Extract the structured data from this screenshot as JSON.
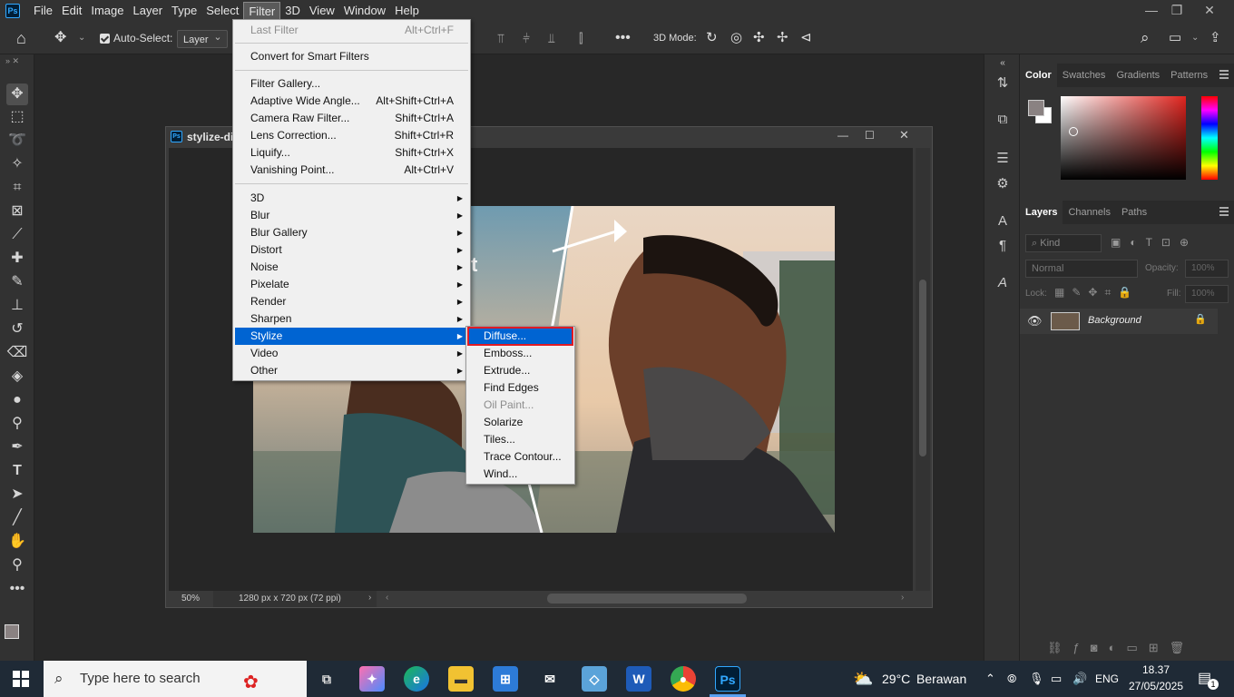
{
  "menubar": {
    "app_icon": "Ps",
    "items": [
      "File",
      "Edit",
      "Image",
      "Layer",
      "Type",
      "Select",
      "Filter",
      "3D",
      "View",
      "Window",
      "Help"
    ],
    "active": "Filter"
  },
  "options": {
    "auto_select_label": "Auto-Select:",
    "auto_select_target": "Layer",
    "mode_3d_label": "3D Mode:"
  },
  "document": {
    "title": "stylize-dif",
    "zoom": "50%",
    "info": "1280 px x 720 px (72 ppi)",
    "photo_text": "t"
  },
  "filter_menu": {
    "items": [
      {
        "label": "Last Filter",
        "shortcut": "Alt+Ctrl+F",
        "disabled": true
      },
      {
        "label": "Convert for Smart Filters",
        "shortcut": ""
      },
      {
        "label": "Filter Gallery...",
        "shortcut": ""
      },
      {
        "label": "Adaptive Wide Angle...",
        "shortcut": "Alt+Shift+Ctrl+A"
      },
      {
        "label": "Camera Raw Filter...",
        "shortcut": "Shift+Ctrl+A"
      },
      {
        "label": "Lens Correction...",
        "shortcut": "Shift+Ctrl+R"
      },
      {
        "label": "Liquify...",
        "shortcut": "Shift+Ctrl+X"
      },
      {
        "label": "Vanishing Point...",
        "shortcut": "Alt+Ctrl+V"
      },
      {
        "label": "3D"
      },
      {
        "label": "Blur"
      },
      {
        "label": "Blur Gallery"
      },
      {
        "label": "Distort"
      },
      {
        "label": "Noise"
      },
      {
        "label": "Pixelate"
      },
      {
        "label": "Render"
      },
      {
        "label": "Sharpen"
      },
      {
        "label": "Stylize"
      },
      {
        "label": "Video"
      },
      {
        "label": "Other"
      }
    ],
    "highlighted": "Stylize"
  },
  "stylize_submenu": {
    "items": [
      "Diffuse...",
      "Emboss...",
      "Extrude...",
      "Find Edges",
      "Oil Paint...",
      "Solarize",
      "Tiles...",
      "Trace Contour...",
      "Wind..."
    ],
    "highlighted": "Diffuse...",
    "disabled": "Oil Paint..."
  },
  "color_panel": {
    "tabs": [
      "Color",
      "Swatches",
      "Gradients",
      "Patterns"
    ],
    "active": "Color",
    "foreground": "#8a8282",
    "background": "#ffffff"
  },
  "layers_panel": {
    "tabs": [
      "Layers",
      "Channels",
      "Paths"
    ],
    "active": "Layers",
    "kind_placeholder": "Kind",
    "blend_mode": "Normal",
    "opacity_label": "Opacity:",
    "opacity_value": "100%",
    "lock_label": "Lock:",
    "fill_label": "Fill:",
    "fill_value": "100%",
    "layers": [
      {
        "name": "Background",
        "visible": true,
        "locked": true
      }
    ]
  },
  "taskbar": {
    "search_placeholder": "Type here to search",
    "weather_temp": "29°C",
    "weather_desc": "Berawan",
    "lang": "ENG",
    "time": "18.37",
    "date": "27/05/2025",
    "notifications": "1"
  }
}
